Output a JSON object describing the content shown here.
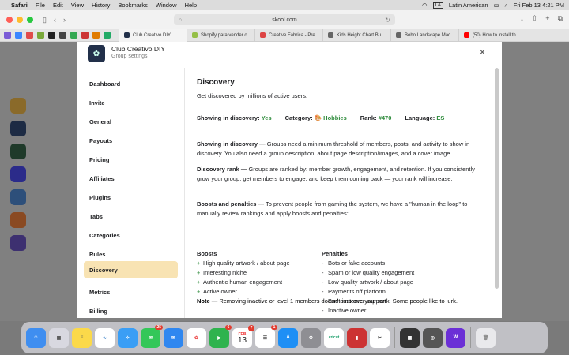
{
  "menubar": {
    "app": "Safari",
    "items": [
      "File",
      "Edit",
      "View",
      "History",
      "Bookmarks",
      "Window",
      "Help"
    ],
    "input_source": "Latin American",
    "clock": "Fri Feb 13  4:21 PM"
  },
  "browser": {
    "url": "skool.com",
    "tabs": [
      "Club Creativo DIY",
      "Shopify para vender o...",
      "Creative Fabrica - Pre...",
      "Kids Height Chart Bu...",
      "Boho Landscape Mac...",
      "(50) How to install th..."
    ]
  },
  "modal": {
    "group_name": "Club Creativo DIY",
    "group_subtitle": "Group settings",
    "close_symbol": "✕",
    "sidebar": [
      "Dashboard",
      "Invite",
      "General",
      "Payouts",
      "Pricing",
      "Affiliates",
      "Plugins",
      "Tabs",
      "Categories",
      "Rules",
      "Discovery",
      "Metrics",
      "Billing"
    ],
    "active_item": "Discovery"
  },
  "discovery": {
    "title": "Discovery",
    "subtitle": "Get discovered by millions of active users.",
    "stats": {
      "showing_label": "Showing in discovery:",
      "showing_value": "Yes",
      "category_label": "Category:",
      "category_value": "🎨 Hobbies",
      "rank_label": "Rank:",
      "rank_value": "#470",
      "language_label": "Language:",
      "language_value": "ES"
    },
    "p1_bold": "Showing in discovery —",
    "p1_text": " Groups need a minimum threshold of members, posts, and activity to show in discovery. You also need a group description, about page description/images, and a cover image.",
    "p2_bold": "Discovery rank —",
    "p2_text": " Groups are ranked by: member growth, engagement, and retention. If you consistently grow your group, get members to engage, and keep them coming back — your rank will increase.",
    "p3_bold": "Boosts and penalties —",
    "p3_text": " To prevent people from gaming the system, we have a \"human in the loop\" to manually review rankings and apply boosts and penalties:",
    "boosts_title": "Boosts",
    "boosts": [
      "High quality artwork / about page",
      "Interesting niche",
      "Authentic human engagement",
      "Active owner"
    ],
    "penalties_title": "Penalties",
    "penalties": [
      "Bots or fake accounts",
      "Spam or low quality engagement",
      "Low quality artwork / about page",
      "Payments off platform",
      "Bad customer support",
      "Inactive owner"
    ],
    "note_bold": "Note —",
    "note_text": " Removing inactive or level 1 members doesn't improve your rank. Some people like to lurk."
  },
  "dock": {
    "badges": {
      "messages": "25",
      "facetime": "6",
      "calendar": "7",
      "reminders": "1",
      "cricut": "1"
    },
    "calendar_month": "FEB",
    "calendar_day": "13",
    "cricut_label": "cricut"
  },
  "colors": {
    "active_sidebar": "#f8e3b3",
    "accent_green": "#2e8b3b"
  }
}
